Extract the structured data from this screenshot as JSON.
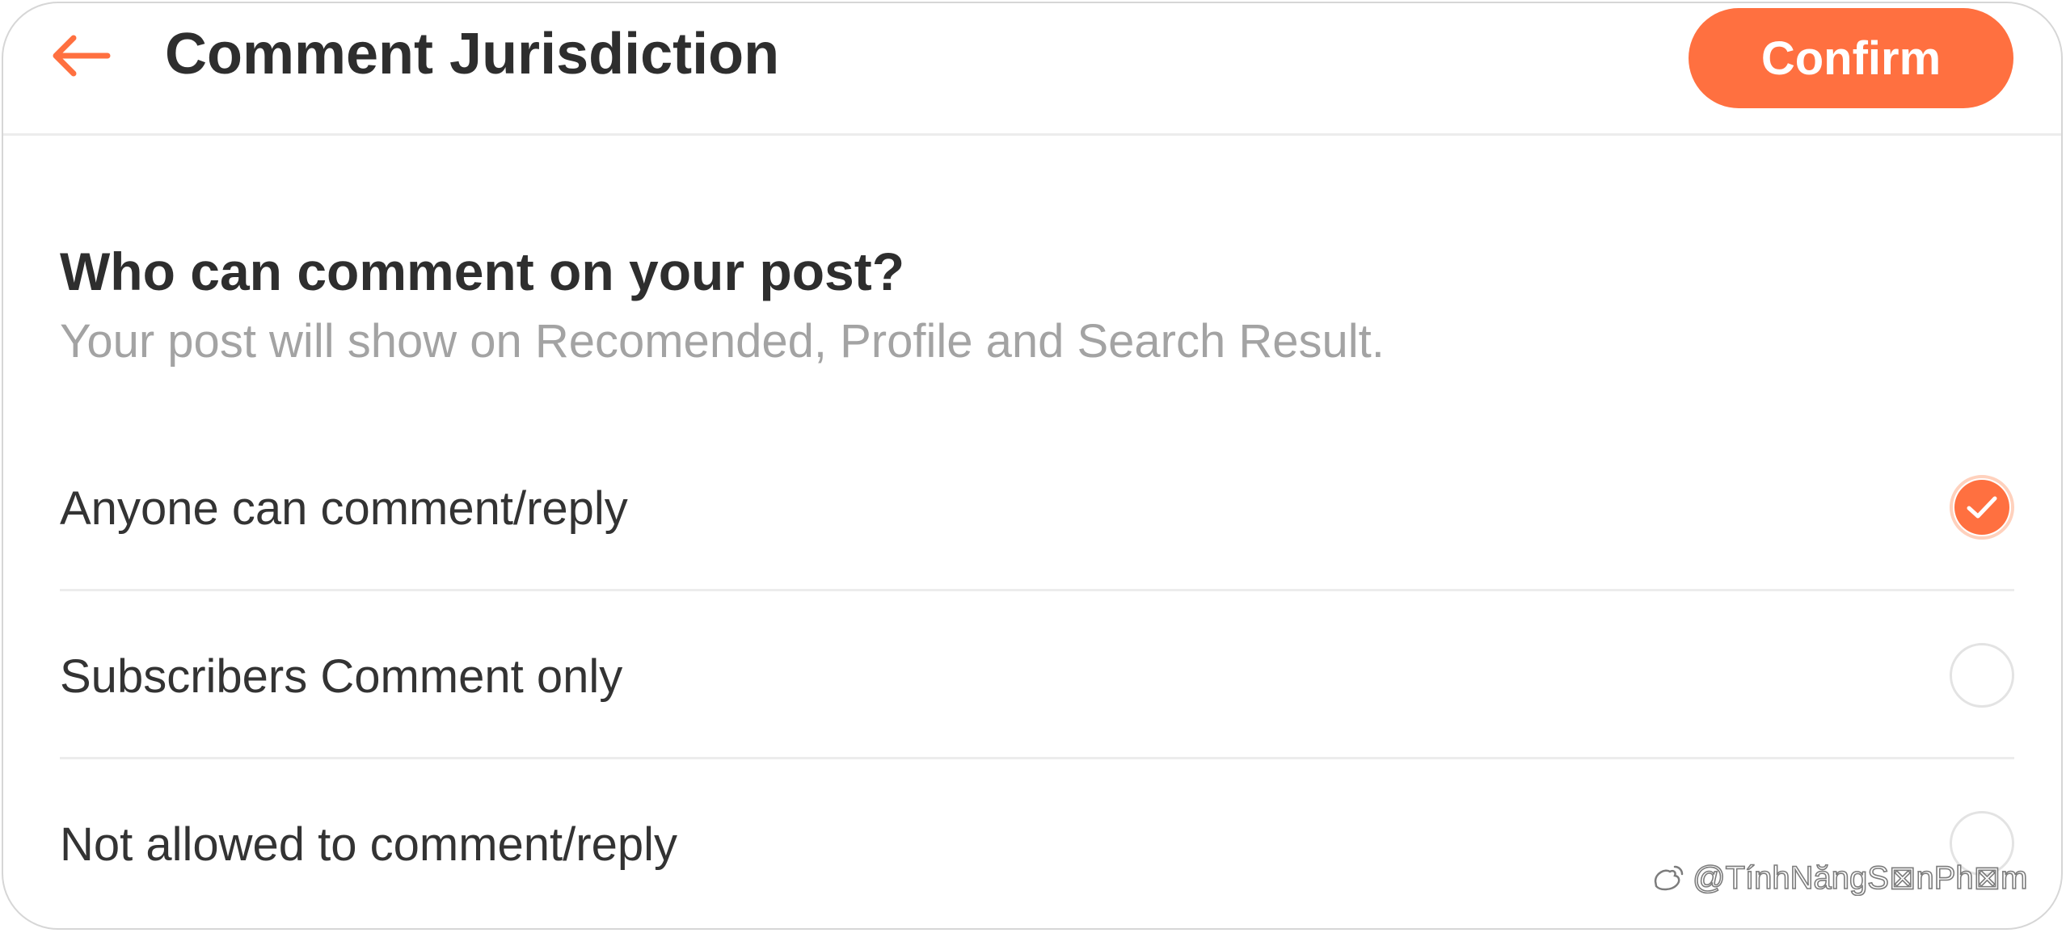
{
  "header": {
    "title": "Comment Jurisdiction",
    "back_icon": "arrow-left-icon",
    "confirm_label": "Confirm"
  },
  "colors": {
    "accent": "#ff7040",
    "title_text": "#2e2e2e",
    "hint_text": "#a3a3a3",
    "divider": "#ececec"
  },
  "section": {
    "question": "Who can comment on your post?",
    "hint": "Your post will show on Recomended, Profile and Search Result."
  },
  "options": [
    {
      "label": "Anyone can comment/reply",
      "selected": true,
      "icon": "checkmark-icon"
    },
    {
      "label": "Subscribers Comment only",
      "selected": false
    },
    {
      "label": "Not allowed to comment/reply",
      "selected": false
    }
  ],
  "watermark": {
    "text": "@TínhNăngS⊠nPh⊠m",
    "icon": "weibo-logo-icon"
  }
}
